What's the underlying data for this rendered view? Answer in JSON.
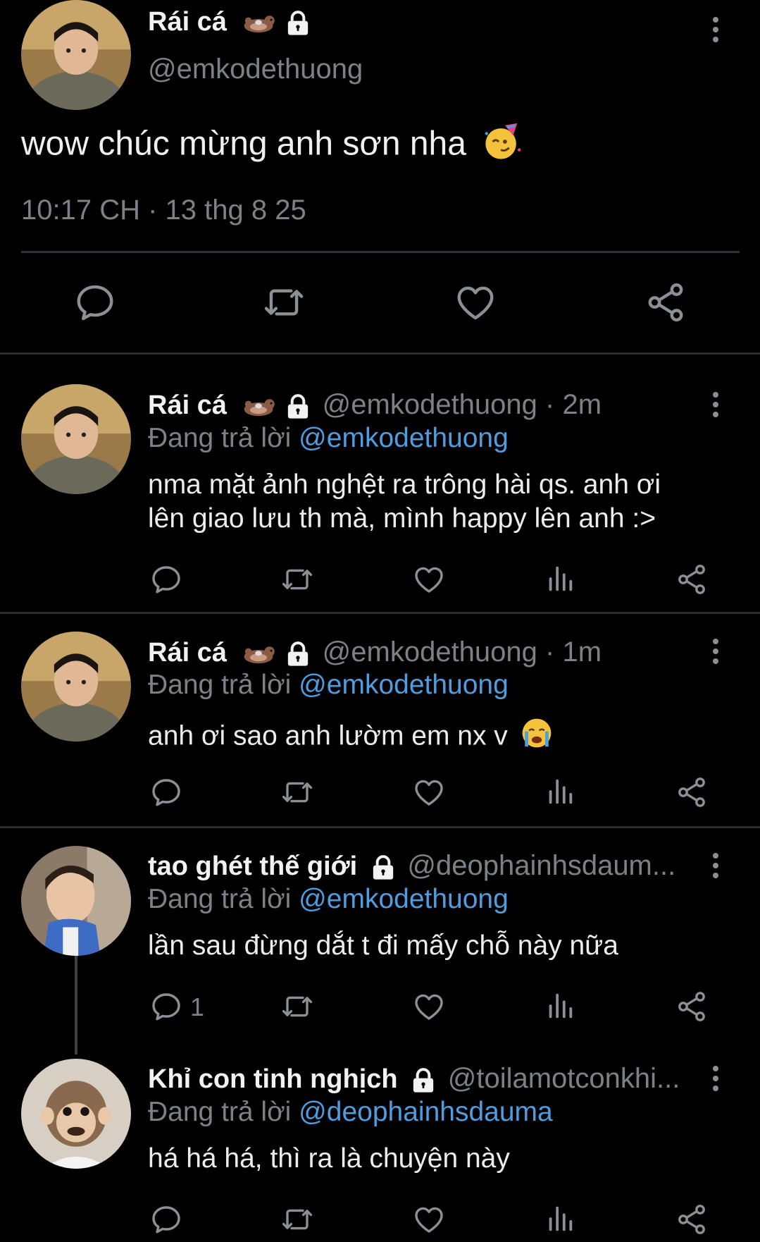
{
  "main_tweet": {
    "name": "Rái cá",
    "handle": "@emkodethuong",
    "text": "wow chúc mừng anh sơn nha",
    "timestamp": "10:17 CH · 13 thg 8 25"
  },
  "replies": [
    {
      "name": "Rái cá",
      "handle_time": "@emkodethuong · 2m",
      "replying_prefix": "Đang trả lời",
      "replying_to": "@emkodethuong",
      "text_line1": "nma mặt ảnh nghệt ra trông hài qs. anh ơi",
      "text_line2": "lên giao lưu th mà, mình happy lên anh :>"
    },
    {
      "name": "Rái cá",
      "handle_time": "@emkodethuong · 1m",
      "replying_prefix": "Đang trả lời",
      "replying_to": "@emkodethuong",
      "text": "anh ơi sao anh lườm em nx v"
    },
    {
      "name": "tao ghét thế giới",
      "handle_time": "@deophainhsdaum...",
      "replying_prefix": "Đang trả lời",
      "replying_to": "@emkodethuong",
      "text": "lần sau đừng dắt t đi mấy chỗ này nữa",
      "reply_count": "1"
    },
    {
      "name": "Khỉ con tinh nghịch",
      "handle_time": "@toilamotconkhi...",
      "replying_prefix": "Đang trả lời",
      "replying_to": "@deophainhsdauma",
      "text": "há há há, thì ra là chuyện này"
    }
  ],
  "icons": {
    "reply": "reply-icon",
    "retweet": "retweet-icon",
    "like": "heart-icon",
    "views": "views-icon",
    "share": "share-icon",
    "more": "more-icon",
    "lock": "lock-icon",
    "otter": "otter-emoji",
    "party": "partying-face-emoji",
    "cry": "crying-face-emoji"
  },
  "colors": {
    "background": "#000000",
    "link": "#4d9de0",
    "secondary_text": "#7b8186",
    "divider": "#2a2d31"
  }
}
